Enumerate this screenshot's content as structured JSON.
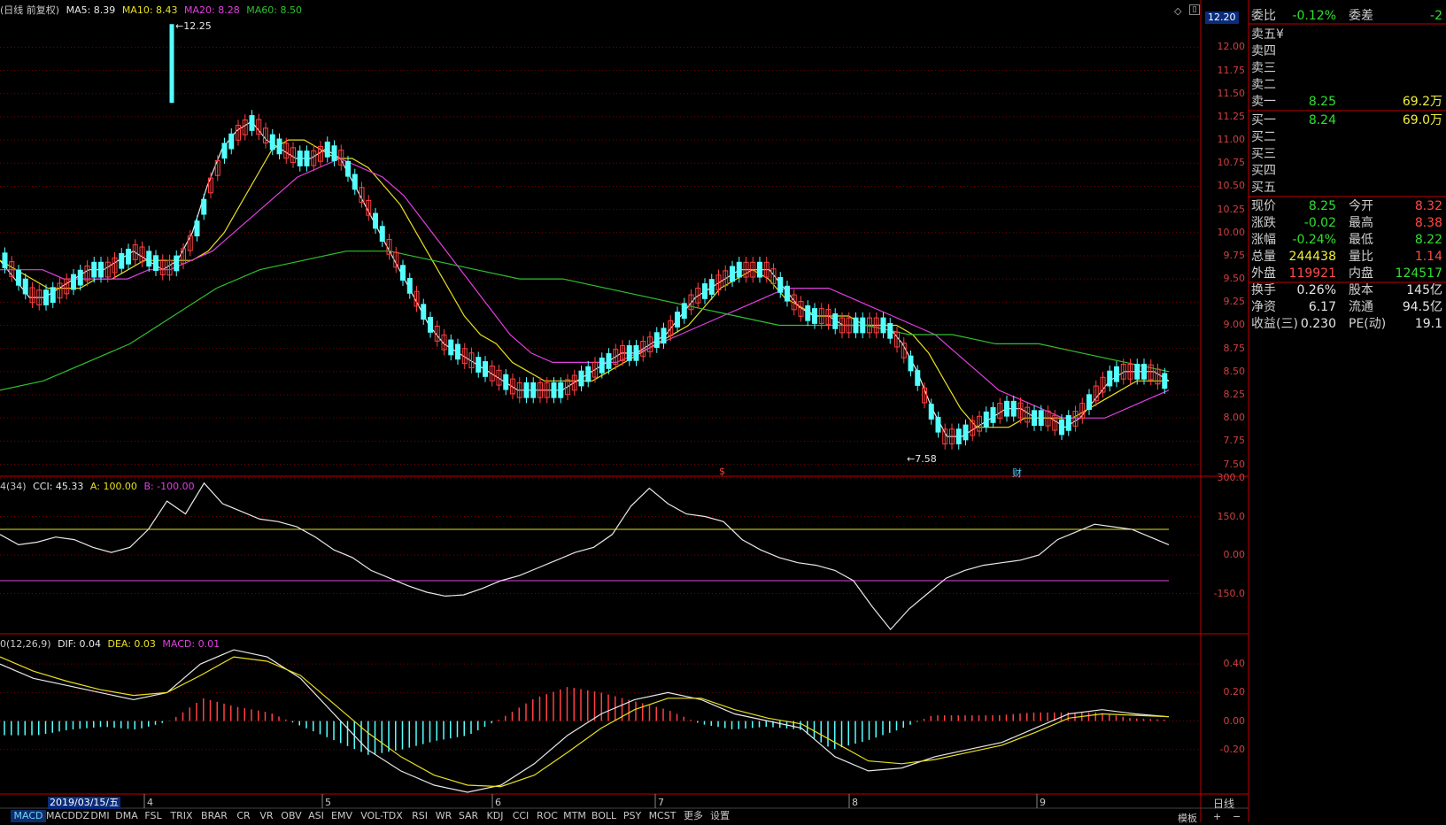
{
  "header": {
    "period": "(日线 前复权)",
    "ma5_label": "MA5: 8.39",
    "ma10_label": "MA10: 8.43",
    "ma20_label": "MA20: 8.28",
    "ma60_label": "MA60: 8.50",
    "cursor_price": "12.20"
  },
  "colors": {
    "up": "#ff4040",
    "down": "#54ffff",
    "ma5": "#e8e8e8",
    "ma10": "#e8e020",
    "ma20": "#e040e0",
    "ma60": "#30c030",
    "grid": "#7a0000",
    "border": "#c00000"
  },
  "price_axis": {
    "ticks": [
      "12.00",
      "11.75",
      "11.50",
      "11.25",
      "11.00",
      "10.75",
      "10.50",
      "10.25",
      "10.00",
      "9.75",
      "9.50",
      "9.25",
      "9.00",
      "8.75",
      "8.50",
      "8.25",
      "8.00",
      "7.75",
      "7.50"
    ]
  },
  "annotations": {
    "high": "12.25",
    "low": "7.58",
    "event1": "$",
    "event2": "财"
  },
  "cci": {
    "title": "4(34)",
    "cci_label": "CCI: 45.33",
    "a_label": "A: 100.00",
    "b_label": "B: -100.00",
    "ticks": [
      "300.0",
      "150.0",
      "0.00",
      "-150.0"
    ]
  },
  "macd": {
    "title": "0(12,26,9)",
    "dif_label": "DIF: 0.04",
    "dea_label": "DEA: 0.03",
    "macd_label": "MACD: 0.01",
    "ticks": [
      "0.40",
      "0.20",
      "0.00",
      "-0.20"
    ]
  },
  "x_axis": {
    "cursor_date": "2019/03/15/五",
    "months": [
      "4",
      "5",
      "6",
      "7",
      "8",
      "9"
    ]
  },
  "tabs": [
    "MACD",
    "MACDDZ",
    "DMI",
    "DMA",
    "FSL",
    "TRIX",
    "BRAR",
    "CR",
    "VR",
    "OBV",
    "ASI",
    "EMV",
    "VOL-TDX",
    "RSI",
    "WR",
    "SAR",
    "KDJ",
    "CCI",
    "ROC",
    "MTM",
    "BOLL",
    "PSY",
    "MCST",
    "更多",
    "设置"
  ],
  "side_buttons": {
    "daily": "日线",
    "template": "模板",
    "plus": "+",
    "minus": "−"
  },
  "quote": {
    "weibi_label": "委比",
    "weibi_value": "-0.12%",
    "weicha_label": "委差",
    "weicha_value": "-2",
    "asks": [
      {
        "label": "卖五",
        "price": "¥",
        "vol": ""
      },
      {
        "label": "卖四",
        "price": "",
        "vol": ""
      },
      {
        "label": "卖三",
        "price": "",
        "vol": ""
      },
      {
        "label": "卖二",
        "price": "",
        "vol": ""
      },
      {
        "label": "卖一",
        "price": "8.25",
        "vol": "69.2万"
      }
    ],
    "bids": [
      {
        "label": "买一",
        "price": "8.24",
        "vol": "69.0万"
      },
      {
        "label": "买二",
        "price": "",
        "vol": ""
      },
      {
        "label": "买三",
        "price": "",
        "vol": ""
      },
      {
        "label": "买四",
        "price": "",
        "vol": ""
      },
      {
        "label": "买五",
        "price": "",
        "vol": ""
      }
    ],
    "stats": [
      {
        "l1": "现价",
        "v1": "8.25",
        "c1": "green",
        "l2": "今开",
        "v2": "8.32",
        "c2": "red"
      },
      {
        "l1": "涨跌",
        "v1": "-0.02",
        "c1": "green",
        "l2": "最高",
        "v2": "8.38",
        "c2": "red"
      },
      {
        "l1": "涨幅",
        "v1": "-0.24%",
        "c1": "green",
        "l2": "最低",
        "v2": "8.22",
        "c2": "green"
      },
      {
        "l1": "总量",
        "v1": "244438",
        "c1": "yellow",
        "l2": "量比",
        "v2": "1.14",
        "c2": "red"
      },
      {
        "l1": "外盘",
        "v1": "119921",
        "c1": "red",
        "l2": "内盘",
        "v2": "124517",
        "c2": "green"
      },
      {
        "l1": "换手",
        "v1": "0.26%",
        "c1": "white",
        "l2": "股本",
        "v2": "145亿",
        "c2": "white"
      },
      {
        "l1": "净资",
        "v1": "6.17",
        "c1": "white",
        "l2": "流通",
        "v2": "94.5亿",
        "c2": "white"
      },
      {
        "l1": "收益(三)",
        "v1": "0.230",
        "c1": "white",
        "l2": "PE(动)",
        "v2": "19.1",
        "c2": "white"
      }
    ]
  },
  "chart_data": [
    {
      "type": "candlestick",
      "title": "",
      "ylim": [
        7.4,
        12.3
      ],
      "series": [
        {
          "name": "MA5",
          "values": [
            9.7,
            9.5,
            9.3,
            9.3,
            9.4,
            9.5,
            9.6,
            9.6,
            9.7,
            9.8,
            9.7,
            9.6,
            9.7,
            10.0,
            10.5,
            10.9,
            11.1,
            11.2,
            11.0,
            10.9,
            10.8,
            10.8,
            10.9,
            10.8,
            10.5,
            10.2,
            9.9,
            9.6,
            9.3,
            9.0,
            8.8,
            8.7,
            8.6,
            8.5,
            8.4,
            8.3,
            8.3,
            8.3,
            8.3,
            8.4,
            8.5,
            8.6,
            8.7,
            8.7,
            8.8,
            8.9,
            9.1,
            9.3,
            9.4,
            9.5,
            9.6,
            9.6,
            9.6,
            9.4,
            9.2,
            9.1,
            9.1,
            9.0,
            9.0,
            9.0,
            9.0,
            8.8,
            8.5,
            8.1,
            7.8,
            7.8,
            7.9,
            8.0,
            8.1,
            8.1,
            8.0,
            8.0,
            7.9,
            8.0,
            8.2,
            8.4,
            8.5,
            8.5,
            8.5,
            8.4
          ]
        },
        {
          "name": "MA10",
          "values": [
            9.7,
            9.6,
            9.5,
            9.4,
            9.4,
            9.4,
            9.5,
            9.5,
            9.6,
            9.7,
            9.7,
            9.7,
            9.7,
            9.8,
            10.0,
            10.3,
            10.6,
            10.9,
            11.0,
            11.0,
            10.9,
            10.8,
            10.8,
            10.7,
            10.5,
            10.3,
            10.0,
            9.7,
            9.4,
            9.1,
            8.9,
            8.8,
            8.6,
            8.5,
            8.4,
            8.4,
            8.4,
            8.4,
            8.5,
            8.6,
            8.7,
            8.8,
            8.9,
            9.0,
            9.2,
            9.4,
            9.5,
            9.6,
            9.5,
            9.3,
            9.2,
            9.1,
            9.1,
            9.1,
            9.0,
            9.0,
            9.0,
            8.9,
            8.7,
            8.4,
            8.1,
            7.9,
            7.9,
            7.9,
            8.0,
            8.0,
            8.0,
            8.0,
            8.1,
            8.2,
            8.3,
            8.4,
            8.4,
            8.4
          ]
        },
        {
          "name": "MA20",
          "values": [
            9.6,
            9.6,
            9.6,
            9.5,
            9.5,
            9.5,
            9.5,
            9.6,
            9.6,
            9.7,
            9.8,
            10.0,
            10.2,
            10.4,
            10.6,
            10.7,
            10.8,
            10.7,
            10.6,
            10.4,
            10.1,
            9.8,
            9.5,
            9.2,
            8.9,
            8.7,
            8.6,
            8.6,
            8.6,
            8.6,
            8.7,
            8.8,
            8.9,
            9.0,
            9.1,
            9.2,
            9.3,
            9.4,
            9.4,
            9.4,
            9.3,
            9.2,
            9.1,
            9.0,
            8.9,
            8.7,
            8.5,
            8.3,
            8.2,
            8.1,
            8.0,
            8.0,
            8.0,
            8.1,
            8.2,
            8.3
          ]
        },
        {
          "name": "MA60",
          "values": [
            8.3,
            8.4,
            8.6,
            8.8,
            9.1,
            9.4,
            9.6,
            9.7,
            9.8,
            9.8,
            9.7,
            9.6,
            9.5,
            9.5,
            9.4,
            9.3,
            9.2,
            9.1,
            9.0,
            9.0,
            9.0,
            8.9,
            8.9,
            8.8,
            8.8,
            8.7,
            8.6,
            8.5
          ]
        }
      ]
    },
    {
      "type": "line",
      "title": "",
      "ylim": [
        -300,
        300
      ],
      "series": [
        {
          "name": "CCI",
          "values": [
            80,
            40,
            50,
            70,
            60,
            30,
            10,
            30,
            100,
            210,
            160,
            280,
            200,
            170,
            140,
            130,
            110,
            70,
            20,
            -10,
            -60,
            -90,
            -120,
            -145,
            -160,
            -155,
            -130,
            -100,
            -80,
            -50,
            -20,
            10,
            30,
            80,
            190,
            260,
            200,
            160,
            150,
            130,
            60,
            20,
            -10,
            -30,
            -40,
            -60,
            -100,
            -200,
            -290,
            -210,
            -150,
            -90,
            -60,
            -40,
            -30,
            -20,
            0,
            60,
            90,
            120,
            110,
            100,
            70,
            40
          ]
        },
        {
          "name": "A",
          "values": [
            100,
            100
          ]
        },
        {
          "name": "B",
          "values": [
            -100,
            -100
          ]
        }
      ]
    },
    {
      "type": "bar+line",
      "title": "",
      "ylim": [
        -0.5,
        0.6
      ],
      "series": [
        {
          "name": "DIF",
          "values": [
            0.4,
            0.3,
            0.25,
            0.2,
            0.15,
            0.2,
            0.4,
            0.5,
            0.45,
            0.3,
            0.05,
            -0.2,
            -0.35,
            -0.45,
            -0.5,
            -0.45,
            -0.3,
            -0.1,
            0.05,
            0.15,
            0.2,
            0.15,
            0.05,
            0.0,
            -0.05,
            -0.25,
            -0.35,
            -0.33,
            -0.25,
            -0.2,
            -0.15,
            -0.05,
            0.05,
            0.08,
            0.05,
            0.03
          ]
        },
        {
          "name": "DEA",
          "values": [
            0.45,
            0.35,
            0.28,
            0.22,
            0.18,
            0.2,
            0.32,
            0.45,
            0.42,
            0.32,
            0.12,
            -0.08,
            -0.25,
            -0.38,
            -0.45,
            -0.46,
            -0.38,
            -0.22,
            -0.05,
            0.08,
            0.16,
            0.16,
            0.08,
            0.02,
            -0.02,
            -0.15,
            -0.28,
            -0.3,
            -0.27,
            -0.22,
            -0.17,
            -0.08,
            0.02,
            0.05,
            0.04,
            0.03
          ]
        },
        {
          "name": "MACD",
          "values": [
            -0.1,
            -0.1,
            -0.06,
            -0.04,
            -0.06,
            0.0,
            0.16,
            0.1,
            0.06,
            -0.04,
            -0.14,
            -0.24,
            -0.2,
            -0.14,
            -0.1,
            0.02,
            0.16,
            0.24,
            0.2,
            0.14,
            0.08,
            -0.02,
            -0.06,
            -0.04,
            -0.06,
            -0.2,
            -0.14,
            -0.06,
            0.04,
            0.04,
            0.04,
            0.06,
            0.06,
            0.06,
            0.02,
            0.01
          ]
        }
      ]
    }
  ]
}
